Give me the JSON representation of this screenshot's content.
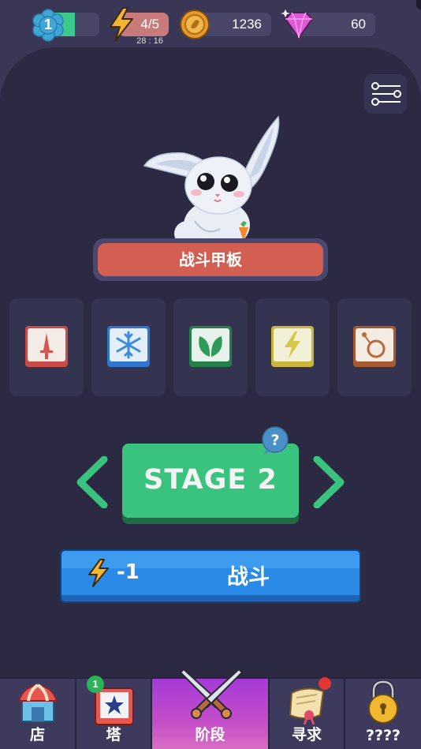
{
  "top_bar": {
    "level": "1",
    "level_progress_fraction": 0.6,
    "energy": "4/5",
    "energy_timer": "28 : 16",
    "coins": "1236",
    "gems": "60"
  },
  "deck": {
    "title": "战斗甲板",
    "slots": [
      {
        "icon": "dagger-icon",
        "color": "#d9534f"
      },
      {
        "icon": "snowflake-icon",
        "color": "#3b8be0"
      },
      {
        "icon": "leaf-icon",
        "color": "#2f9a5a"
      },
      {
        "icon": "lightning-icon",
        "color": "#d6c64a"
      },
      {
        "icon": "bomb-icon",
        "color": "#b86a3c"
      }
    ]
  },
  "stage": {
    "label": "STAGE 2",
    "help": "?"
  },
  "fight": {
    "cost": "-1",
    "label": "战斗"
  },
  "nav": {
    "shop": "店",
    "tower": "塔",
    "tower_badge": "1",
    "stage": "阶段",
    "quest": "寻求",
    "locked": "????"
  },
  "colors": {
    "background": "#2b2a42",
    "accent_green": "#3ac37e",
    "accent_blue": "#2a8be6",
    "accent_red": "#d25f52",
    "nav_active": "#b544d2"
  }
}
